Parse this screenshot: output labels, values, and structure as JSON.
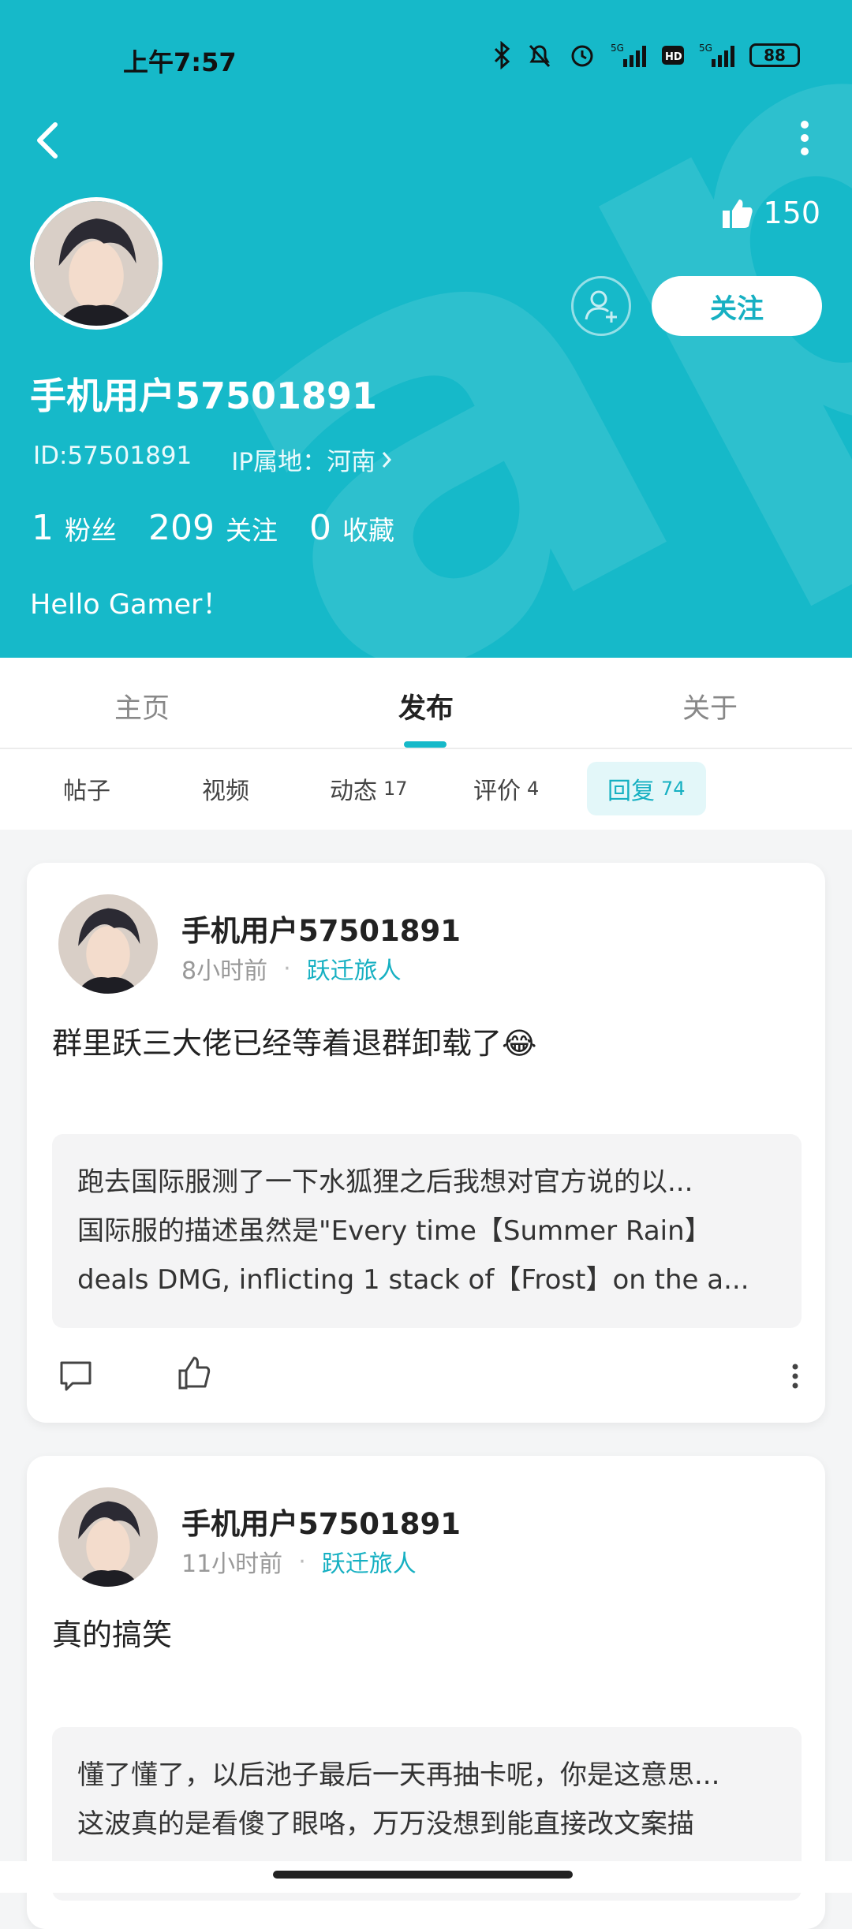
{
  "status_bar": {
    "time": "上午7:57",
    "network": "5G",
    "battery": "88"
  },
  "profile": {
    "likes": "150",
    "follow_label": "关注",
    "username": "手机用户57501891",
    "id_text": "ID:57501891",
    "ip_text": "IP属地：河南",
    "stats": [
      {
        "num": "1",
        "label": "粉丝"
      },
      {
        "num": "209",
        "label": "关注"
      },
      {
        "num": "0",
        "label": "收藏"
      }
    ],
    "bio": "Hello Gamer！"
  },
  "tabs": [
    "主页",
    "发布",
    "关于"
  ],
  "subtabs": [
    {
      "label": "帖子",
      "count": ""
    },
    {
      "label": "视频",
      "count": ""
    },
    {
      "label": "动态",
      "count": "17"
    },
    {
      "label": "评价",
      "count": "4"
    },
    {
      "label": "回复",
      "count": "74"
    }
  ],
  "posts": [
    {
      "author": "手机用户57501891",
      "time": "8小时前",
      "tag": "跃迁旅人",
      "text": "群里跃三大佬已经等着退群卸载了😂",
      "quote": [
        "跑去国际服测了一下水狐狸之后我想对官方说的以...",
        "国际服的描述虽然是\"Every time【Summer Rain】",
        "deals DMG, inflicting 1 stack of【Frost】on the a..."
      ]
    },
    {
      "author": "手机用户57501891",
      "time": "11小时前",
      "tag": "跃迁旅人",
      "text": "真的搞笑",
      "quote": [
        "懂了懂了，以后池子最后一天再抽卡呢，你是这意思...",
        "这波真的是看傻了眼咯，万万没想到能直接改文案描"
      ]
    }
  ],
  "colors": {
    "accent": "#16b9c9",
    "header_bg": "#16b9c9"
  }
}
